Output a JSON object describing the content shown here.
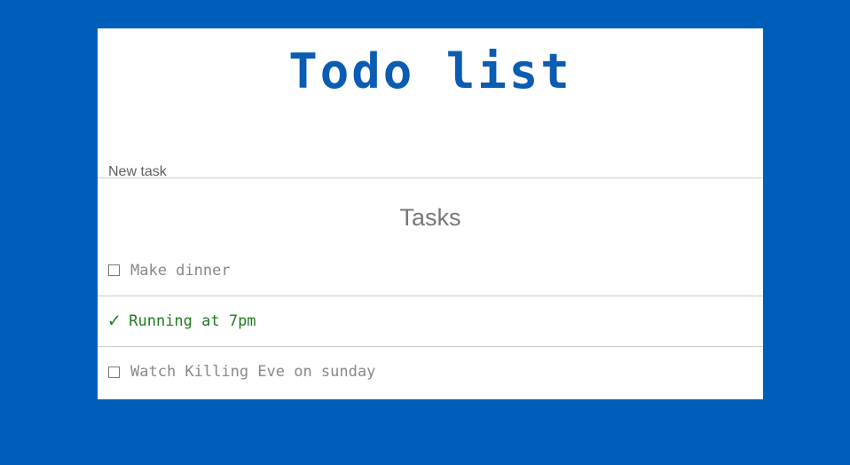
{
  "app": {
    "title": "Todo list"
  },
  "new_task": {
    "placeholder": "New task",
    "value": ""
  },
  "tasks_heading": "Tasks",
  "tasks": [
    {
      "text": "Make dinner",
      "done": false
    },
    {
      "text": "Running at 7pm",
      "done": true
    },
    {
      "text": "Watch Killing Eve on sunday",
      "done": false
    }
  ],
  "colors": {
    "background": "#005EBB",
    "title": "#0B5CB3",
    "done": "#1E7A1E",
    "pending": "#888888"
  },
  "icons": {
    "unchecked": "checkbox-empty-icon",
    "checked": "checkmark-icon"
  }
}
